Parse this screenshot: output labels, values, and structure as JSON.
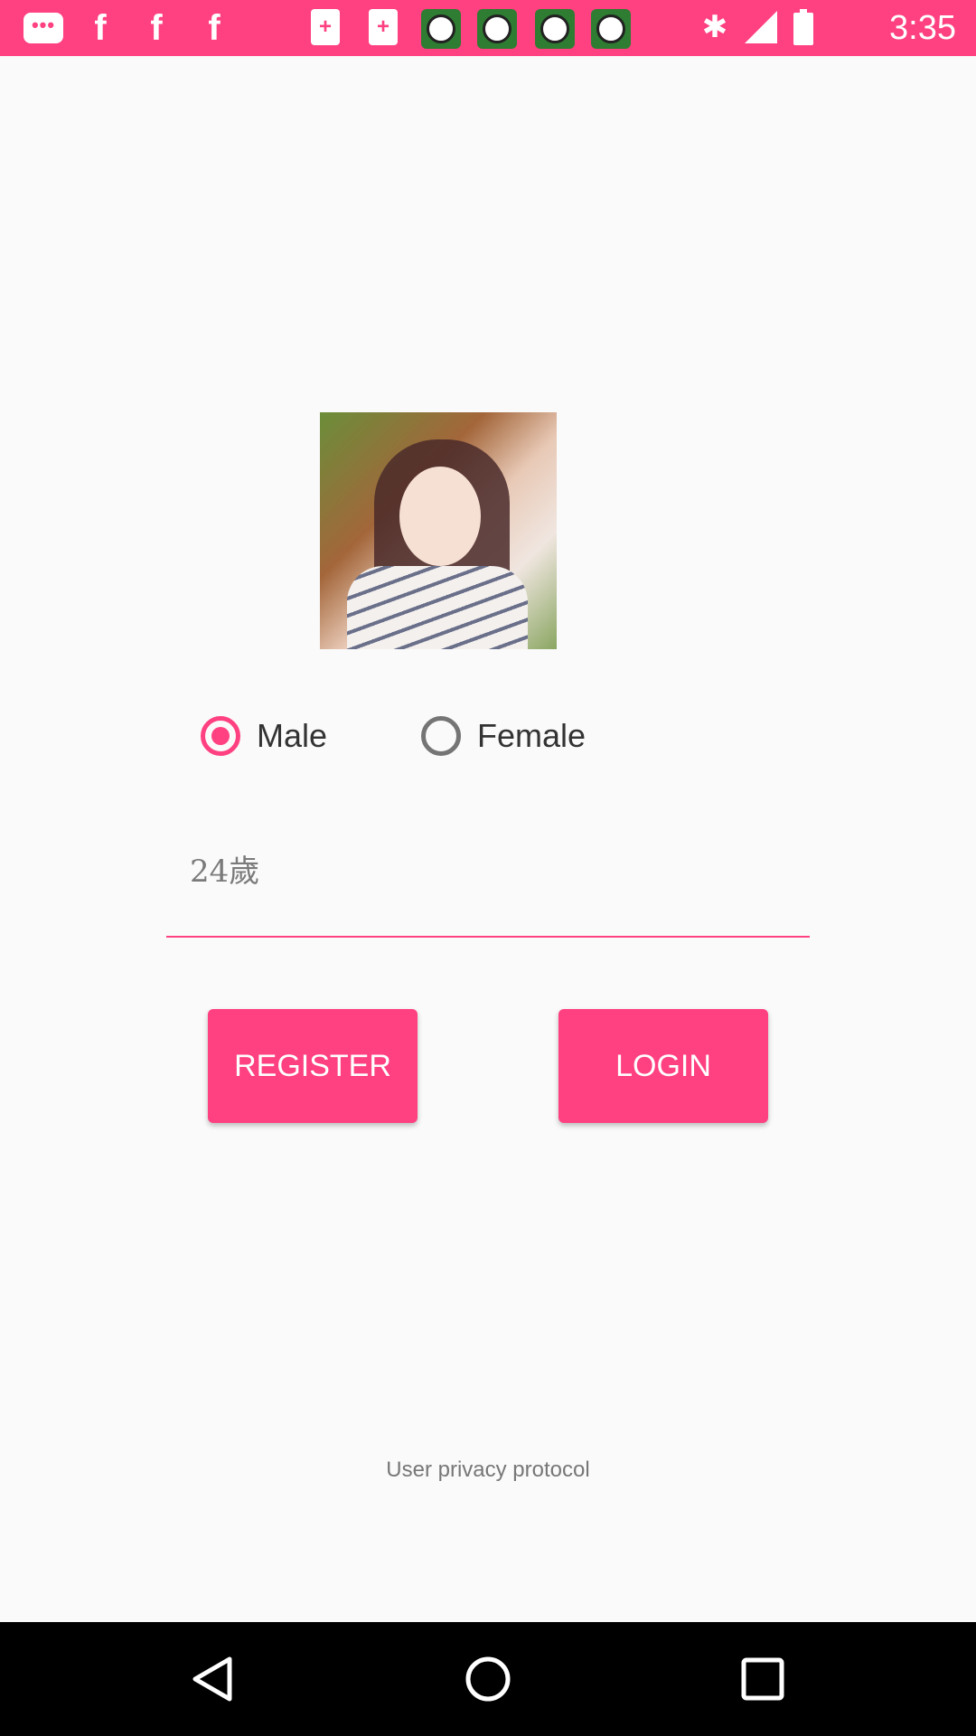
{
  "status_bar": {
    "time": "3:35",
    "background_color": "#ff4081",
    "icons": [
      "message-icon",
      "facebook-icon",
      "facebook-icon",
      "facebook-icon",
      "document-icon",
      "document-icon",
      "soccer-app-icon",
      "soccer-app-icon",
      "soccer-app-icon",
      "soccer-app-icon",
      "bluetooth-icon",
      "signal-icon",
      "battery-icon"
    ]
  },
  "profile": {
    "avatar_alt": "profile photo"
  },
  "gender": {
    "options": [
      {
        "label": "Male",
        "selected": true
      },
      {
        "label": "Female",
        "selected": false
      }
    ]
  },
  "age_field": {
    "value": "24歲"
  },
  "actions": {
    "register_label": "REGISTER",
    "login_label": "LOGIN"
  },
  "footer": {
    "privacy_link": "User privacy protocol"
  },
  "colors": {
    "accent": "#ff4081",
    "background": "#fafafa"
  }
}
